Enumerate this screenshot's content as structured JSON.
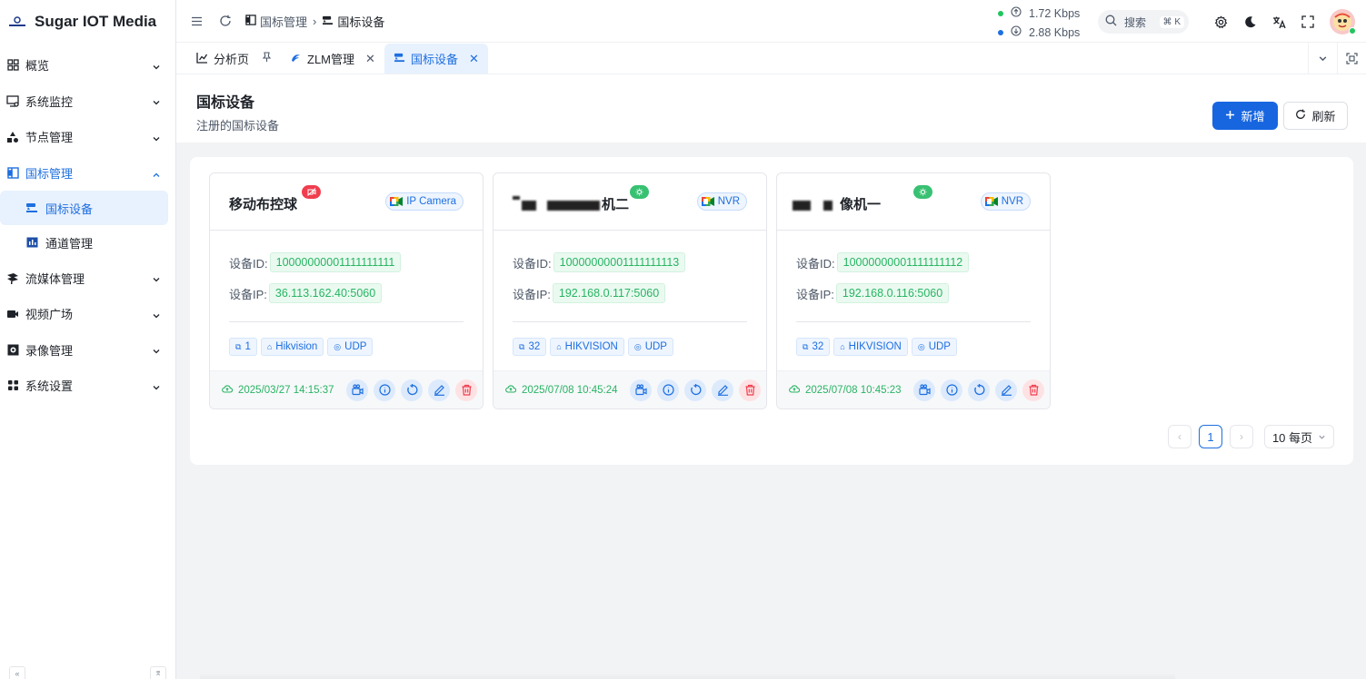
{
  "app": {
    "title": "Sugar IOT Media"
  },
  "sidebar": {
    "items": [
      {
        "label": "概览",
        "icon": "grid-icon"
      },
      {
        "label": "系统监控",
        "icon": "monitor-icon"
      },
      {
        "label": "节点管理",
        "icon": "nodes-icon"
      },
      {
        "label": "国标管理",
        "icon": "book-icon",
        "open": true
      },
      {
        "label": "流媒体管理",
        "icon": "stream-icon"
      },
      {
        "label": "视频广场",
        "icon": "video-icon"
      },
      {
        "label": "录像管理",
        "icon": "record-icon"
      },
      {
        "label": "系统设置",
        "icon": "settings-grid-icon"
      }
    ],
    "sub_items": [
      {
        "label": "国标设备",
        "icon": "camera-icon",
        "active": true
      },
      {
        "label": "通道管理",
        "icon": "channel-icon"
      }
    ]
  },
  "header": {
    "breadcrumb": [
      "国标管理",
      "国标设备"
    ],
    "net_up": "1.72 Kbps",
    "net_down": "2.88 Kbps",
    "search_placeholder": "搜索",
    "search_shortcut": "⌘ K"
  },
  "tabs": [
    {
      "label": "分析页",
      "icon": "chart-icon",
      "pinned": true
    },
    {
      "label": "ZLM管理",
      "icon": "dolphin-icon",
      "closable": true
    },
    {
      "label": "国标设备",
      "icon": "camera-icon",
      "closable": true,
      "active": true
    }
  ],
  "page": {
    "title": "国标设备",
    "subtitle": "注册的国标设备",
    "add_label": "新增",
    "refresh_label": "刷新"
  },
  "devices": [
    {
      "name": "移动布控球",
      "online": false,
      "type": "IP Camera",
      "id_label": "设备ID:",
      "id": "10000000001111111111",
      "ip_label": "设备IP:",
      "ip": "36.113.162.40:5060",
      "channels": "1",
      "vendor": "Hikvision",
      "transport": "UDP",
      "time": "2025/03/27 14:15:37"
    },
    {
      "name": "机二",
      "online": true,
      "type": "NVR",
      "id_label": "设备ID:",
      "id": "10000000001111111113",
      "ip_label": "设备IP:",
      "ip": "192.168.0.117:5060",
      "channels": "32",
      "vendor": "HIKVISION",
      "transport": "UDP",
      "time": "2025/07/08 10:45:24"
    },
    {
      "name": "像机一",
      "online": true,
      "type": "NVR",
      "id_label": "设备ID:",
      "id": "10000000001111111112",
      "ip_label": "设备IP:",
      "ip": "192.168.0.116:5060",
      "channels": "32",
      "vendor": "HIKVISION",
      "transport": "UDP",
      "time": "2025/07/08 10:45:23"
    }
  ],
  "pagination": {
    "current": "1",
    "page_size": "10 每页"
  },
  "colors": {
    "primary": "#1766e0",
    "success": "#28b463",
    "danger": "#f03e4e"
  }
}
